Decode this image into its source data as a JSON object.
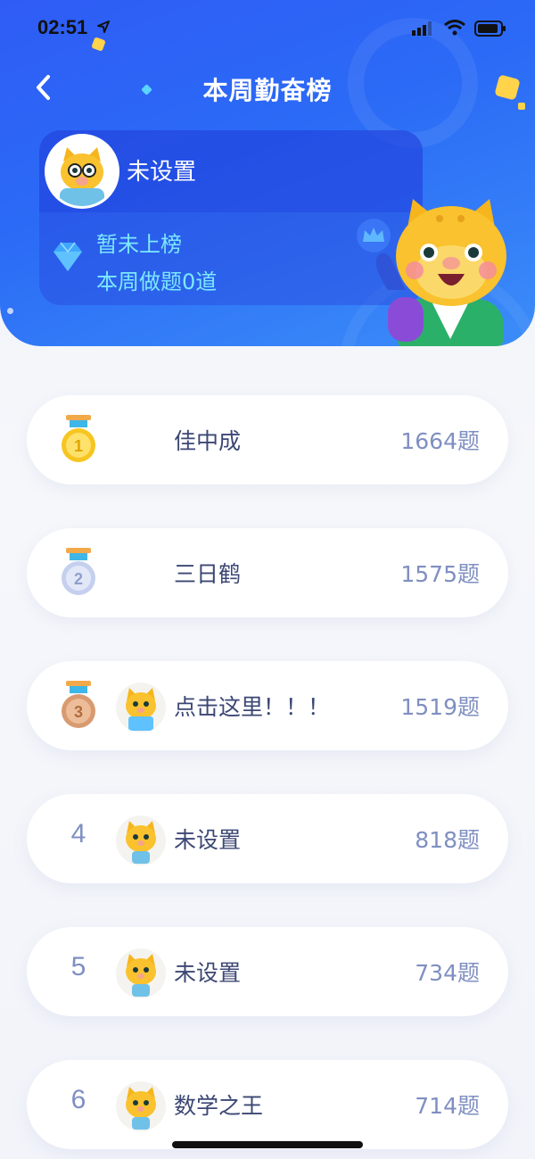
{
  "status_bar": {
    "time": "02:51"
  },
  "header": {
    "title": "本周勤奋榜",
    "back_icon": "chevron-left-icon"
  },
  "profile": {
    "name": "未设置",
    "rank_status": "暂未上榜",
    "weekly_count": "本周做题0道"
  },
  "colors": {
    "header_blue": "#2f5cf5",
    "accent_cyan": "#7ce8ff",
    "gold": "#f7c520",
    "silver": "#c5d0ef",
    "bronze": "#d89a70",
    "rank_text": "#7f8fc1",
    "name_text": "#3c4774"
  },
  "leaderboard": [
    {
      "rank": "1",
      "badge": "gold-medal-icon",
      "name": "佳中成",
      "score": "1664题",
      "has_avatar": false
    },
    {
      "rank": "2",
      "badge": "silver-medal-icon",
      "name": "三日鹤",
      "score": "1575题",
      "has_avatar": false
    },
    {
      "rank": "3",
      "badge": "bronze-medal-icon",
      "name": "点击这里！！！",
      "score": "1519题",
      "has_avatar": true
    },
    {
      "rank": "4",
      "name": "未设置",
      "score": "818题",
      "has_avatar": true
    },
    {
      "rank": "5",
      "name": "未设置",
      "score": "734题",
      "has_avatar": true
    },
    {
      "rank": "6",
      "name": "数学之王",
      "score": "714题",
      "has_avatar": true
    }
  ]
}
